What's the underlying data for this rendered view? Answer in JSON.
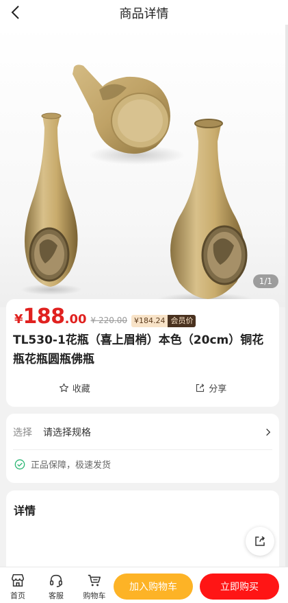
{
  "header": {
    "title": "商品详情"
  },
  "gallery": {
    "counter": "1/1"
  },
  "product": {
    "currency": "¥",
    "price_int": "188",
    "price_dec": ".00",
    "original_price": "¥ 220.00",
    "member_price": "¥184.24",
    "member_tag": "会员价",
    "title": "TL530-1花瓶（喜上眉梢）本色（20cm）铜花瓶花瓶圆瓶佛瓶",
    "favorite_label": "收藏",
    "share_label": "分享"
  },
  "spec": {
    "key": "选择",
    "value": "请选择规格",
    "guarantee": "正品保障，极速发货"
  },
  "detail": {
    "title": "详情"
  },
  "bottom_bar": {
    "home_label": "首页",
    "service_label": "客服",
    "cart_label": "购物车",
    "add_cart_label": "加入购物车",
    "buy_label": "立即购买"
  },
  "colors": {
    "price_red": "#e0211f",
    "cart_button": "#fdb326",
    "buy_button": "#ff1515",
    "check_green": "#2bb673"
  },
  "icons": [
    "back-icon",
    "star-icon",
    "share-icon",
    "chevron-right-icon",
    "check-circle-icon",
    "store-icon",
    "headset-icon",
    "cart-icon"
  ]
}
